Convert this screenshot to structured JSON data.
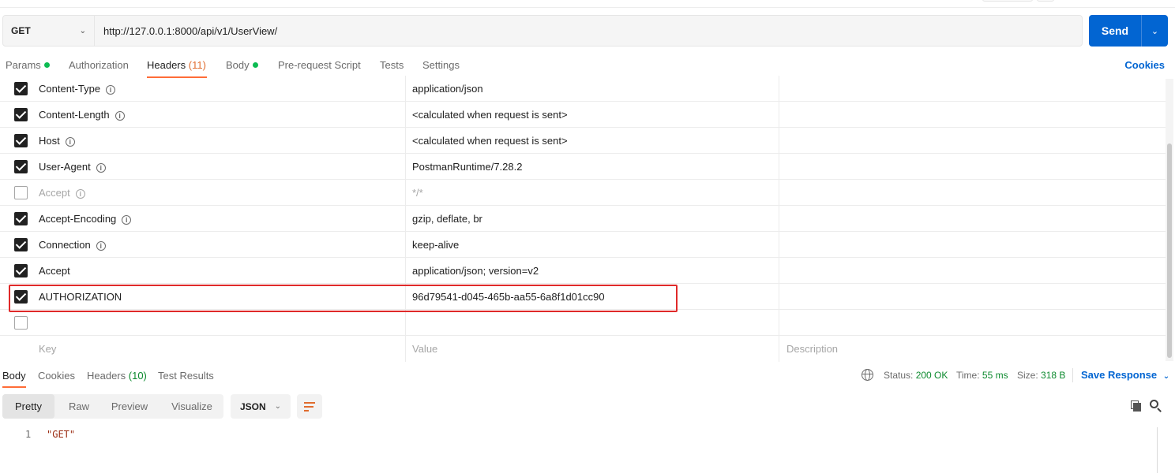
{
  "request": {
    "method": "GET",
    "url": "http://127.0.0.1:8000/api/v1/UserView/",
    "send_label": "Send"
  },
  "request_tabs": {
    "params": "Params",
    "authorization": "Authorization",
    "headers": "Headers",
    "headers_count": "(11)",
    "body": "Body",
    "prerequest": "Pre-request Script",
    "tests": "Tests",
    "settings": "Settings",
    "cookies": "Cookies",
    "active": "Headers"
  },
  "headers": {
    "rows": [
      {
        "key": "Content-Type",
        "value": "application/json",
        "checked": true,
        "info": true
      },
      {
        "key": "Content-Length",
        "value": "<calculated when request is sent>",
        "checked": true,
        "info": true
      },
      {
        "key": "Host",
        "value": "<calculated when request is sent>",
        "checked": true,
        "info": true
      },
      {
        "key": "User-Agent",
        "value": "PostmanRuntime/7.28.2",
        "checked": true,
        "info": true
      },
      {
        "key": "Accept",
        "value": "*/*",
        "checked": false,
        "info": true
      },
      {
        "key": "Accept-Encoding",
        "value": "gzip, deflate, br",
        "checked": true,
        "info": true
      },
      {
        "key": "Connection",
        "value": "keep-alive",
        "checked": true,
        "info": true
      },
      {
        "key": "Accept",
        "value": "application/json; version=v2",
        "checked": true,
        "info": false
      },
      {
        "key": "AUTHORIZATION",
        "value": "96d79541-d045-465b-aa55-6a8f1d01cc90",
        "checked": true,
        "info": false,
        "highlighted": true
      }
    ],
    "placeholders": {
      "key": "Key",
      "value": "Value",
      "description": "Description"
    }
  },
  "response_tabs": {
    "body": "Body",
    "cookies": "Cookies",
    "headers": "Headers",
    "headers_count": "(10)",
    "test_results": "Test Results",
    "active": "Body"
  },
  "response_status": {
    "status_label": "Status:",
    "status_value": "200 OK",
    "time_label": "Time:",
    "time_value": "55 ms",
    "size_label": "Size:",
    "size_value": "318 B",
    "save_response": "Save Response"
  },
  "response_view": {
    "modes": [
      "Pretty",
      "Raw",
      "Preview",
      "Visualize"
    ],
    "active_mode": "Pretty",
    "format": "JSON"
  },
  "response_body": {
    "lines": [
      {
        "number": "1",
        "text": "\"GET\""
      }
    ]
  },
  "colors": {
    "accent_blue": "#0265d2",
    "tab_underline": "#ff6c37",
    "status_green": "#0c8a2e",
    "highlight_red": "#e02a2a"
  },
  "icons": {
    "info": "info-circle-icon",
    "globe": "globe-icon",
    "copy": "copy-icon",
    "search": "search-icon",
    "wrap": "word-wrap-icon"
  }
}
